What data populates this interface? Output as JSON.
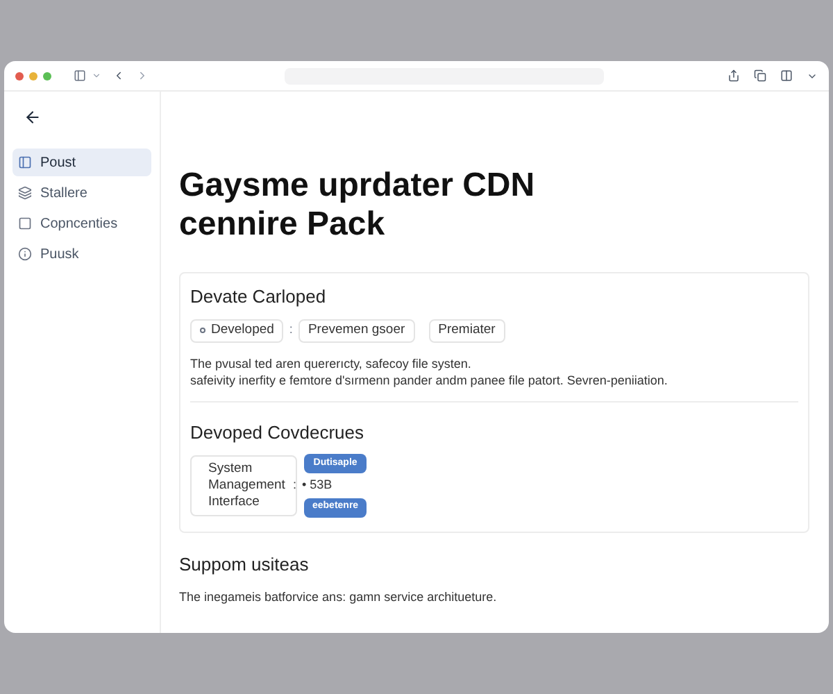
{
  "sidebar": {
    "items": [
      {
        "label": "Poust",
        "selected": true
      },
      {
        "label": "Stallere",
        "selected": false
      },
      {
        "label": "Copncenties",
        "selected": false
      },
      {
        "label": "Puusk",
        "selected": false
      }
    ]
  },
  "page": {
    "title": "Gaysme uprdater CDN cennire Pack"
  },
  "card": {
    "heading": "Devate Carloped",
    "chips": [
      {
        "label": "Developed",
        "dot": true
      },
      {
        "label": "Prevemen gsoer",
        "dot": false
      },
      {
        "label": "Premiater",
        "dot": false
      }
    ],
    "chip_separator": ":",
    "body": [
      "The pvusal ted aren quererıcty, safecoy file systen.",
      "safeivity inerfity e femtore d'sırmenn pander andm panee file patort. Sevren-peniiation."
    ],
    "subheading": "Devoped Covdecrues",
    "system_box": "System Management Interface",
    "tags": [
      "Dutisaple",
      "eebetenre"
    ],
    "reading_separator": ":",
    "reading": "• 53B"
  },
  "section": {
    "heading": "Suppom usiteas",
    "text": "The inegameis batforvice ans: gamn service architueture."
  }
}
